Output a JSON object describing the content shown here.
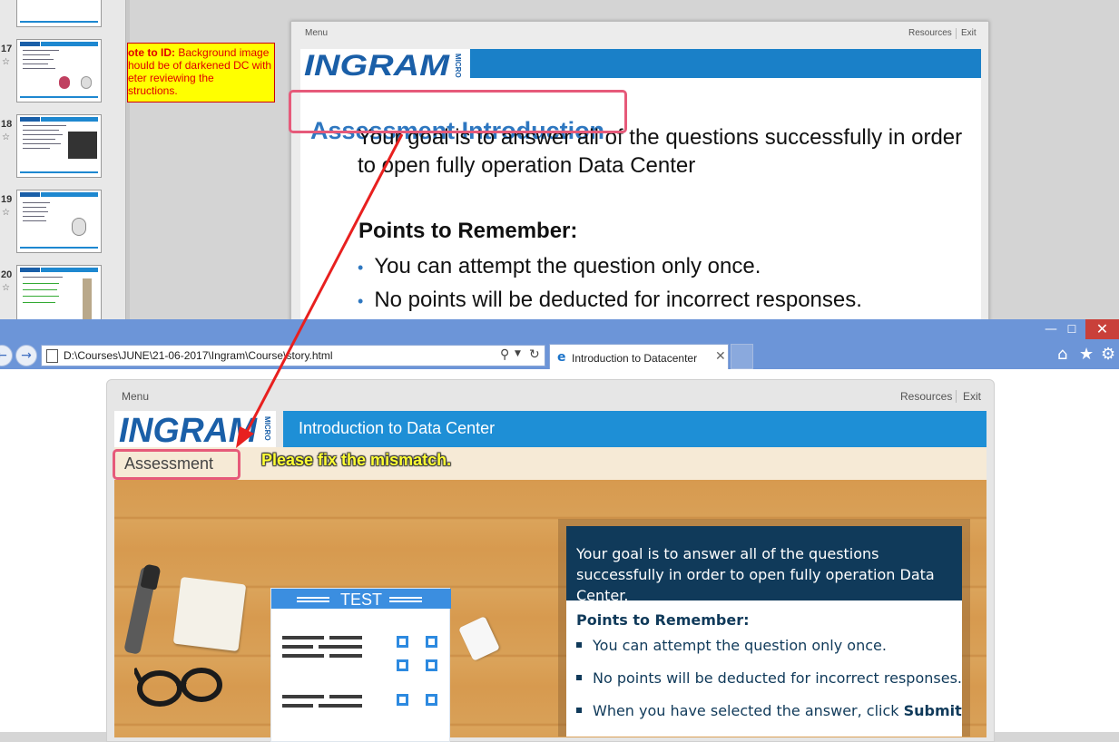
{
  "slide_sorter": {
    "thumbnails": [
      {
        "number": "17"
      },
      {
        "number": "18"
      },
      {
        "number": "19"
      },
      {
        "number": "20"
      }
    ]
  },
  "note": {
    "prefix": "ote to ID:",
    "lines": [
      "Background image",
      "hould be of darkened DC with",
      "eter reviewing the",
      "structions."
    ]
  },
  "ppt_slide": {
    "menu": "Menu",
    "resources": "Resources",
    "exit": "Exit",
    "logo": "INGRAM",
    "logo_sub": "MICRO",
    "title": "Assessment Introduction",
    "goal": "Your goal is to answer all of the questions successfully in order to open fully operation Data Center",
    "points_heading": "Points to Remember:",
    "bullets": [
      "You can attempt the question only once.",
      "No points will be deducted for incorrect responses."
    ]
  },
  "browser": {
    "window_buttons": {
      "minimize": "—",
      "maximize": "☐",
      "close": "✕"
    },
    "back": "←",
    "forward": "→",
    "address": "D:\\Courses\\JUNE\\21-06-2017\\Ingram\\Course\\story.html",
    "search_icon": "⚲",
    "refresh_icon": "↻",
    "tab_title": "Introduction to Datacenter",
    "tab_close": "✕",
    "tool_icons": {
      "home": "⌂",
      "favorites": "★",
      "settings": "⚙"
    }
  },
  "course": {
    "menu": "Menu",
    "resources": "Resources",
    "exit": "Exit",
    "logo": "INGRAM",
    "logo_sub": "MICRO",
    "header_title": "Introduction to Data Center",
    "section_title": "Assessment",
    "test_label": "TEST",
    "goal": "Your goal is to answer all of the questions successfully in order to open fully operation Data Center.",
    "points_heading": "Points to Remember:",
    "bullets": [
      "You can attempt the question only once.",
      "No points will be deducted for incorrect responses."
    ],
    "bullet3_prefix": "When you have selected the answer, click ",
    "bullet3_bold": "Submit"
  },
  "annotation": {
    "message": "Please fix the mismatch.",
    "highlight_color": "#e65a7a",
    "arrow_color": "#e8201f"
  },
  "colors": {
    "ingram_blue": "#1a5fa8",
    "header_blue": "#1e8fd6",
    "panel_navy": "#103a5a",
    "note_yellow": "#ffff00"
  }
}
